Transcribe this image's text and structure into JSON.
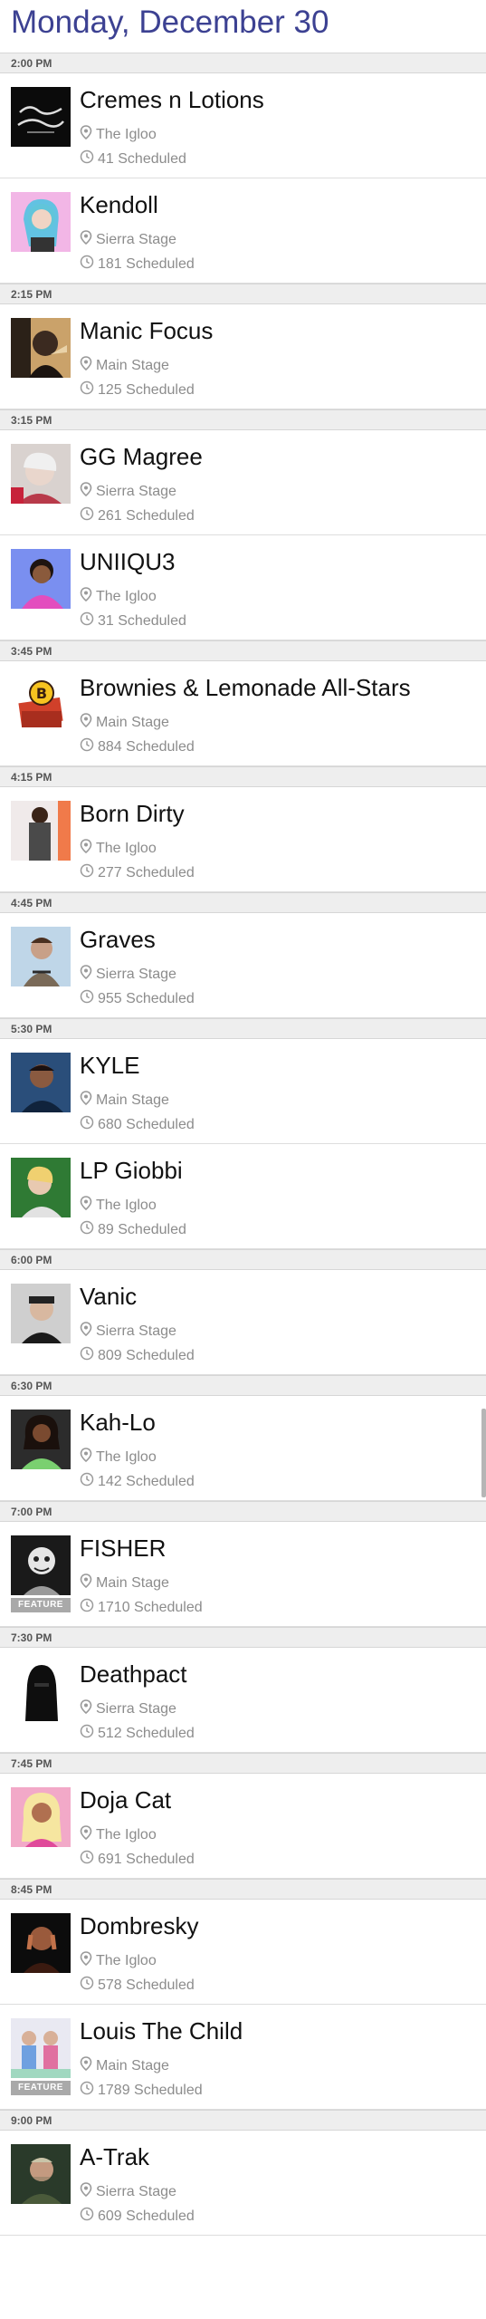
{
  "header": {
    "title": "Monday, December 30"
  },
  "icons": {
    "stage": "map-pin-icon",
    "scheduled": "clock-icon"
  },
  "colors": {
    "title": "#3c4192",
    "header_bg": "#eeeeee",
    "meta_text": "#8c8c8c",
    "badge_bg": "#a9a9a9"
  },
  "groups": [
    {
      "time": "2:00 PM",
      "events": [
        {
          "name": "Cremes n Lotions",
          "stage": "The Igloo",
          "scheduled": "41 Scheduled",
          "art": "cremes"
        },
        {
          "name": "Kendoll",
          "stage": "Sierra Stage",
          "scheduled": "181 Scheduled",
          "art": "kendoll"
        }
      ]
    },
    {
      "time": "2:15 PM",
      "events": [
        {
          "name": "Manic Focus",
          "stage": "Main Stage",
          "scheduled": "125 Scheduled",
          "art": "manic"
        }
      ]
    },
    {
      "time": "3:15 PM",
      "events": [
        {
          "name": "GG Magree",
          "stage": "Sierra Stage",
          "scheduled": "261 Scheduled",
          "art": "gg"
        },
        {
          "name": "UNIIQU3",
          "stage": "The Igloo",
          "scheduled": "31 Scheduled",
          "art": "uniiqu3"
        }
      ]
    },
    {
      "time": "3:45 PM",
      "events": [
        {
          "name": "Brownies & Lemonade All-Stars",
          "stage": "Main Stage",
          "scheduled": "884 Scheduled",
          "art": "brownies"
        }
      ]
    },
    {
      "time": "4:15 PM",
      "events": [
        {
          "name": "Born Dirty",
          "stage": "The Igloo",
          "scheduled": "277 Scheduled",
          "art": "borndirty"
        }
      ]
    },
    {
      "time": "4:45 PM",
      "events": [
        {
          "name": "Graves",
          "stage": "Sierra Stage",
          "scheduled": "955 Scheduled",
          "art": "graves"
        }
      ]
    },
    {
      "time": "5:30 PM",
      "events": [
        {
          "name": "KYLE",
          "stage": "Main Stage",
          "scheduled": "680 Scheduled",
          "art": "kyle"
        },
        {
          "name": "LP Giobbi",
          "stage": "The Igloo",
          "scheduled": "89 Scheduled",
          "art": "lpgiobbi"
        }
      ]
    },
    {
      "time": "6:00 PM",
      "events": [
        {
          "name": "Vanic",
          "stage": "Sierra Stage",
          "scheduled": "809 Scheduled",
          "art": "vanic"
        }
      ]
    },
    {
      "time": "6:30 PM",
      "events": [
        {
          "name": "Kah-Lo",
          "stage": "The Igloo",
          "scheduled": "142 Scheduled",
          "art": "kahlo"
        }
      ]
    },
    {
      "time": "7:00 PM",
      "events": [
        {
          "name": "FISHER",
          "stage": "Main Stage",
          "scheduled": "1710 Scheduled",
          "art": "fisher",
          "badge": "FEATURE"
        }
      ]
    },
    {
      "time": "7:30 PM",
      "events": [
        {
          "name": "Deathpact",
          "stage": "Sierra Stage",
          "scheduled": "512 Scheduled",
          "art": "deathpact"
        }
      ]
    },
    {
      "time": "7:45 PM",
      "events": [
        {
          "name": "Doja Cat",
          "stage": "The Igloo",
          "scheduled": "691 Scheduled",
          "art": "doja"
        }
      ]
    },
    {
      "time": "8:45 PM",
      "events": [
        {
          "name": "Dombresky",
          "stage": "The Igloo",
          "scheduled": "578 Scheduled",
          "art": "dombresky"
        },
        {
          "name": "Louis The Child",
          "stage": "Main Stage",
          "scheduled": "1789 Scheduled",
          "art": "ltc",
          "badge": "FEATURE"
        }
      ]
    },
    {
      "time": "9:00 PM",
      "events": [
        {
          "name": "A-Trak",
          "stage": "Sierra Stage",
          "scheduled": "609 Scheduled",
          "art": "atrak"
        }
      ]
    }
  ]
}
